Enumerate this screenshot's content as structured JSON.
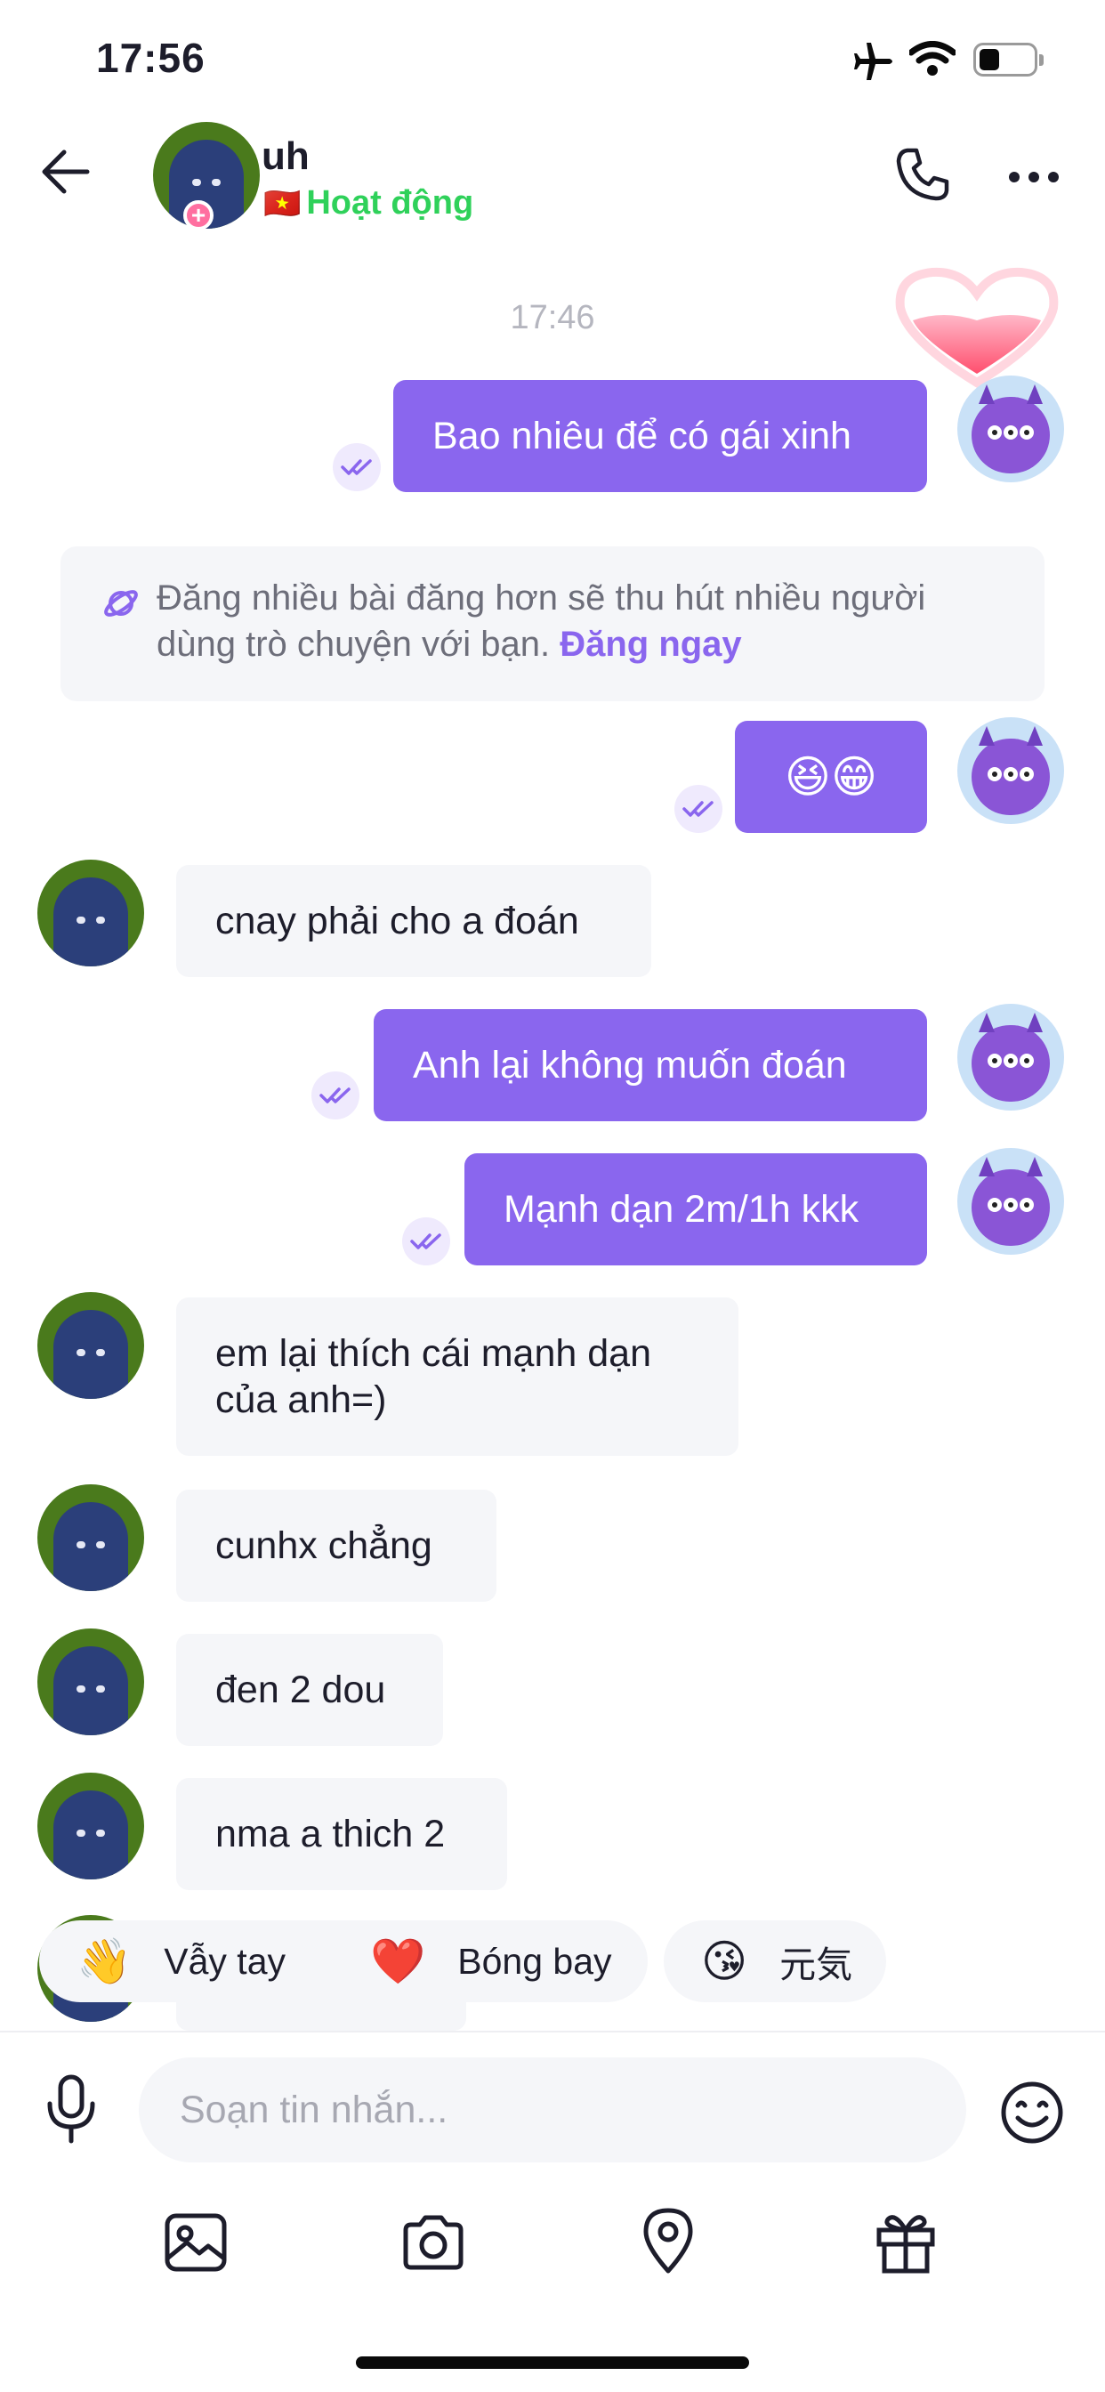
{
  "status_bar": {
    "time": "17:56"
  },
  "header": {
    "name": "uh",
    "flag": "🇻🇳",
    "status": "Hoạt động"
  },
  "timestamp": "17:46",
  "messages": [
    {
      "side": "out",
      "text": "Bao nhiêu để có gái xinh"
    },
    {
      "side": "out",
      "text": "😆😁"
    },
    {
      "side": "in",
      "text": "cnay phải cho a đoán"
    },
    {
      "side": "out",
      "text": "Anh lại không muốn đoán"
    },
    {
      "side": "out",
      "text": "Mạnh dạn 2m/1h kkk"
    },
    {
      "side": "in",
      "text_line1": "em lại thích cái mạnh dạn",
      "text_line2": "của anh=)"
    },
    {
      "side": "in",
      "text": "cunhx chẳng"
    },
    {
      "side": "in",
      "text": "đen 2 dou"
    },
    {
      "side": "in",
      "text": "nma a thich 2"
    }
  ],
  "notice": {
    "text": "Đăng nhiều bài đăng hơn sẽ thu hút nhiều người dùng trò chuyện với bạn.",
    "link": "Đăng ngay"
  },
  "quick_reactions": [
    {
      "emoji": "👋",
      "label": "Vẫy tay"
    },
    {
      "emoji": "❤️",
      "label": "Bóng bay"
    },
    {
      "emoji": "😘",
      "label": "元気"
    }
  ],
  "composer": {
    "placeholder": "Soạn tin nhắn..."
  },
  "colors": {
    "accent": "#8a66ee",
    "online": "#2fd15a",
    "incoming_bg": "#f5f6f9"
  }
}
